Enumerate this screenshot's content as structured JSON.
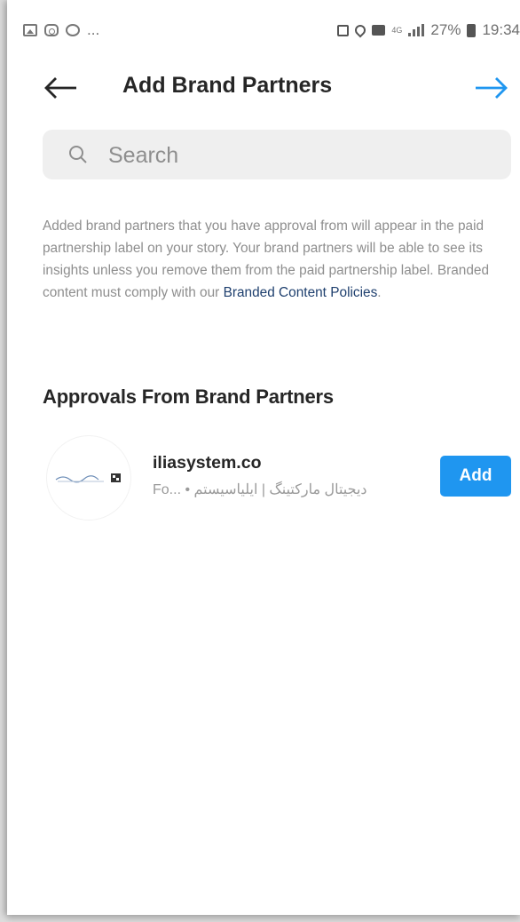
{
  "status_bar": {
    "left_icons": [
      "gallery-icon",
      "instagram-icon",
      "whatsapp-icon"
    ],
    "left_more": "...",
    "network_tag": "4G",
    "battery_percent": "27%",
    "time": "19:34"
  },
  "header": {
    "title": "Add Brand Partners",
    "back_icon": "arrow-left-icon",
    "next_icon": "arrow-right-icon",
    "accent_color": "#1f96f0"
  },
  "search": {
    "placeholder": "Search",
    "value": ""
  },
  "description": {
    "text": "Added brand partners that you have approval from will appear in the paid partnership label on your story. Your brand partners will be able to see its insights unless you remove them from the paid partnership label. Branded content must comply with our ",
    "link": "Branded Content Policies",
    "end": "."
  },
  "approvals": {
    "title": "Approvals From Brand Partners",
    "partners": [
      {
        "name": "iliasystem.co",
        "subtitle": "Fo... • دیجیتال مارکتینگ | ایلیاسیستم",
        "add_label": "Add"
      }
    ]
  }
}
